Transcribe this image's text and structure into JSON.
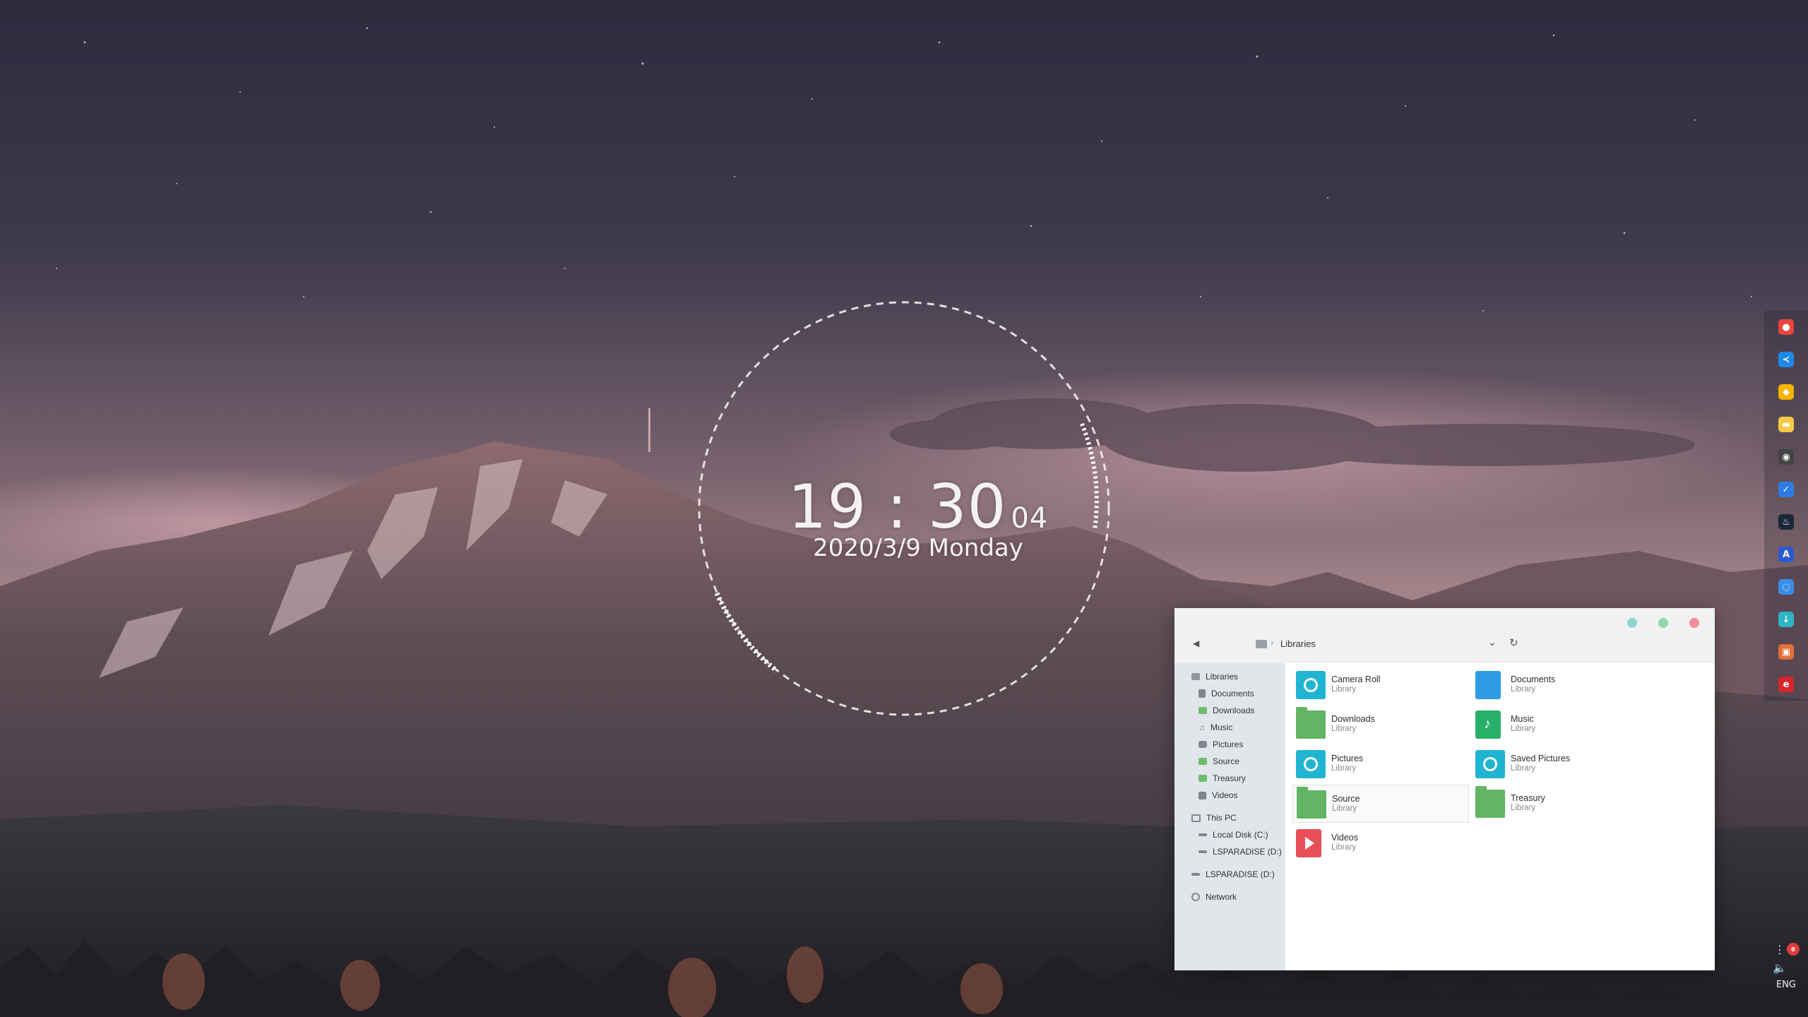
{
  "clock": {
    "hours": "19",
    "separator": ":",
    "minutes": "30",
    "seconds": "04",
    "date": "2020/3/9 Monday"
  },
  "dock": {
    "items": [
      {
        "icon": "chrome-icon",
        "color": "#e8453c"
      },
      {
        "icon": "vscode-icon",
        "color": "#1e88e5"
      },
      {
        "icon": "kite-icon",
        "color": "#f4b400"
      },
      {
        "icon": "folder-icon",
        "color": "#f7c948"
      },
      {
        "icon": "davinci-icon",
        "color": "#444444"
      },
      {
        "icon": "todo-icon",
        "color": "#2f7be5"
      },
      {
        "icon": "steam-icon",
        "color": "#1b2838"
      },
      {
        "icon": "translate-icon",
        "color": "#2c5bd1"
      },
      {
        "icon": "network-icon",
        "color": "#3a8ee6"
      },
      {
        "icon": "download-icon",
        "color": "#2eb5c6"
      },
      {
        "icon": "office-icon",
        "color": "#e0703a"
      },
      {
        "icon": "netease-music-icon",
        "color": "#d8252b"
      }
    ]
  },
  "tray": {
    "more": "⋮",
    "volume_icon": "speaker-icon",
    "language": "ENG"
  },
  "explorer": {
    "address": {
      "separator": "›",
      "location": "Libraries"
    },
    "navigation": {
      "libraries": "Libraries",
      "library_items": [
        "Documents",
        "Downloads",
        "Music",
        "Pictures",
        "Source",
        "Treasury",
        "Videos"
      ],
      "this_pc": "This PC",
      "pc_items": [
        "Local Disk (C:)",
        "LSPARADISE (D:)"
      ],
      "drive": "LSPARADISE (D:)",
      "network": "Network"
    },
    "tiles": [
      {
        "name": "Camera Roll",
        "type": "Library",
        "icon": "camera-roll-icon"
      },
      {
        "name": "Documents",
        "type": "Library",
        "icon": "documents-icon"
      },
      {
        "name": "Downloads",
        "type": "Library",
        "icon": "downloads-folder-icon"
      },
      {
        "name": "Music",
        "type": "Library",
        "icon": "music-icon"
      },
      {
        "name": "Pictures",
        "type": "Library",
        "icon": "pictures-icon"
      },
      {
        "name": "Saved Pictures",
        "type": "Library",
        "icon": "saved-pictures-icon"
      },
      {
        "name": "Source",
        "type": "Library",
        "icon": "source-folder-icon",
        "selected": true
      },
      {
        "name": "Treasury",
        "type": "Library",
        "icon": "treasury-folder-icon"
      },
      {
        "name": "Videos",
        "type": "Library",
        "icon": "videos-icon"
      }
    ]
  }
}
